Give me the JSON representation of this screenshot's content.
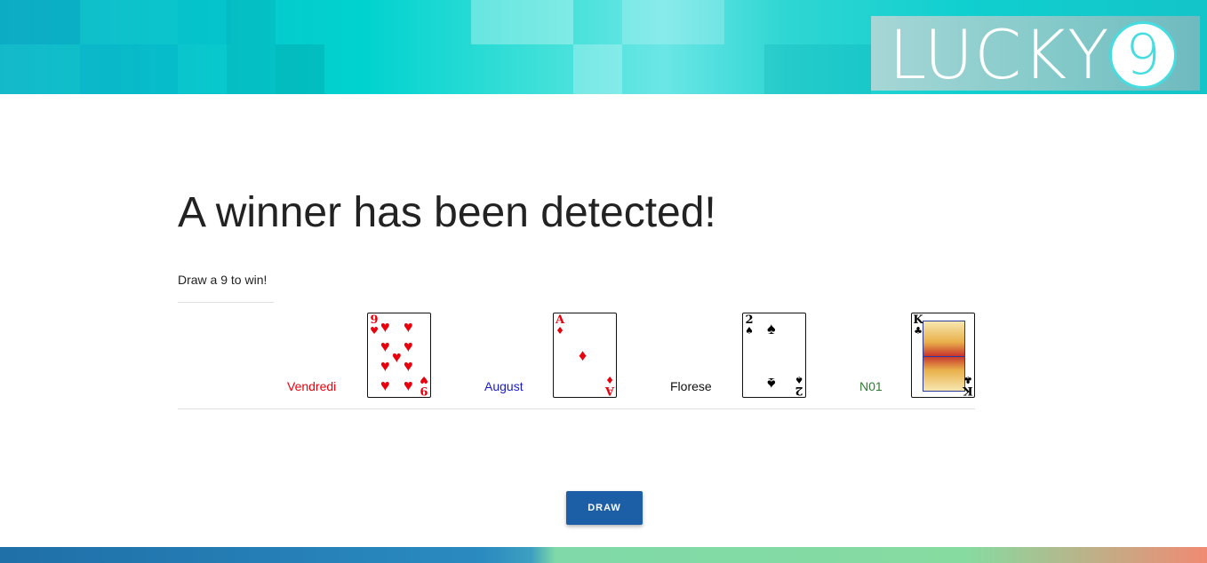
{
  "header": {
    "logo_text": "LUCKY",
    "logo_number": "9"
  },
  "main": {
    "title": "A winner has been detected!",
    "subtitle": "Draw a 9 to win!"
  },
  "players": [
    {
      "name": "Vendredi",
      "color": "#e8000d",
      "card": {
        "rank": "9",
        "suit": "hearts",
        "suit_symbol": "♥",
        "color": "red"
      }
    },
    {
      "name": "August",
      "color": "#1a1ad0",
      "card": {
        "rank": "A",
        "suit": "diamonds",
        "suit_symbol": "♦",
        "color": "red"
      }
    },
    {
      "name": "Florese",
      "color": "#111111",
      "card": {
        "rank": "2",
        "suit": "spades",
        "suit_symbol": "♠",
        "color": "black"
      }
    },
    {
      "name": "N01",
      "color": "#2e7d32",
      "card": {
        "rank": "K",
        "suit": "clubs",
        "suit_symbol": "♣",
        "color": "black"
      }
    }
  ],
  "actions": {
    "draw_label": "DRAW"
  },
  "colors": {
    "button": "#1d5fa6",
    "banner": "#00d2cf"
  }
}
